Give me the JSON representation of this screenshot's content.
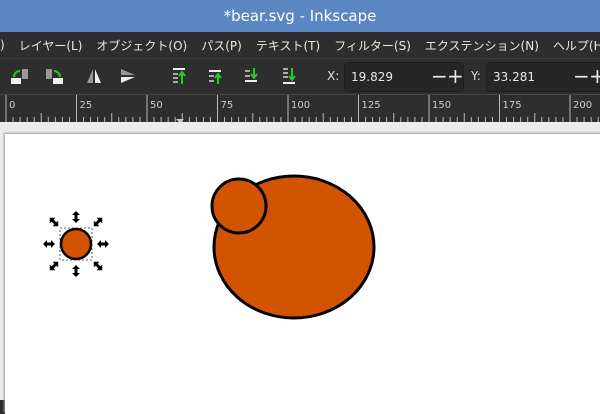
{
  "window": {
    "title": "*bear.svg - Inkscape"
  },
  "menu": [
    ")",
    "レイヤー(L)",
    "オブジェクト(O)",
    "パス(P)",
    "テキスト(T)",
    "フィルター(S)",
    "エクステンション(N)",
    "ヘルプ(H)"
  ],
  "toolbar": {
    "icons": [
      "rotate-ccw-icon",
      "rotate-cw-icon",
      "flip-horizontal-icon",
      "flip-vertical-icon",
      "raise-to-top-icon",
      "raise-icon",
      "lower-icon",
      "lower-to-bottom-icon"
    ],
    "x_label": "X:",
    "x_value": "19.829",
    "y_label": "Y:",
    "y_value": "33.281"
  },
  "ruler": {
    "labels": [
      "0",
      "25",
      "50",
      "75",
      "100",
      "125",
      "150",
      "175",
      "200"
    ]
  },
  "colors": {
    "fill": "#d35400",
    "stroke": "#000000"
  }
}
